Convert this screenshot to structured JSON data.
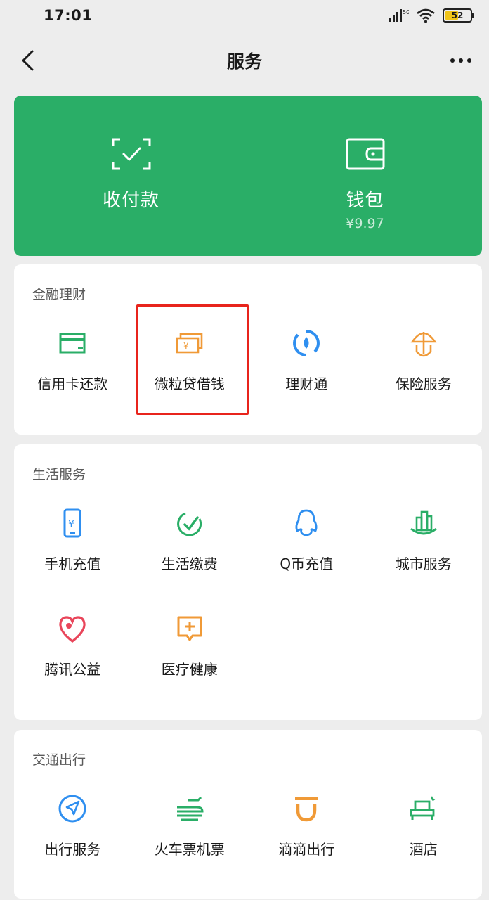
{
  "status": {
    "time": "17:01",
    "signal_label": "5G",
    "battery_level": "52"
  },
  "nav": {
    "title": "服务"
  },
  "top_card": {
    "pay": {
      "label": "收付款"
    },
    "wallet": {
      "label": "钱包",
      "balance": "¥9.97"
    }
  },
  "sections": {
    "finance": {
      "title": "金融理财",
      "items": [
        {
          "label": "信用卡还款",
          "icon": "credit-card-icon"
        },
        {
          "label": "微粒贷借钱",
          "icon": "cash-notes-icon"
        },
        {
          "label": "理财通",
          "icon": "wealth-drop-icon"
        },
        {
          "label": "保险服务",
          "icon": "umbrella-shield-icon"
        }
      ]
    },
    "life": {
      "title": "生活服务",
      "items": [
        {
          "label": "手机充值",
          "icon": "phone-yen-icon"
        },
        {
          "label": "生活缴费",
          "icon": "check-leaf-icon"
        },
        {
          "label": "Q币充值",
          "icon": "qq-penguin-icon"
        },
        {
          "label": "城市服务",
          "icon": "city-buildings-icon"
        },
        {
          "label": "腾讯公益",
          "icon": "heart-charity-icon"
        },
        {
          "label": "医疗健康",
          "icon": "medical-plus-icon"
        }
      ]
    },
    "travel": {
      "title": "交通出行",
      "items": [
        {
          "label": "出行服务",
          "icon": "navigation-arrow-icon"
        },
        {
          "label": "火车票机票",
          "icon": "train-plane-icon"
        },
        {
          "label": "滴滴出行",
          "icon": "didi-icon"
        },
        {
          "label": "酒店",
          "icon": "hotel-bed-icon"
        }
      ]
    }
  },
  "colors": {
    "brand_green": "#2aae67",
    "highlight_red": "#e8241c",
    "orange": "#f09a37",
    "blue": "#2f8ff0"
  }
}
